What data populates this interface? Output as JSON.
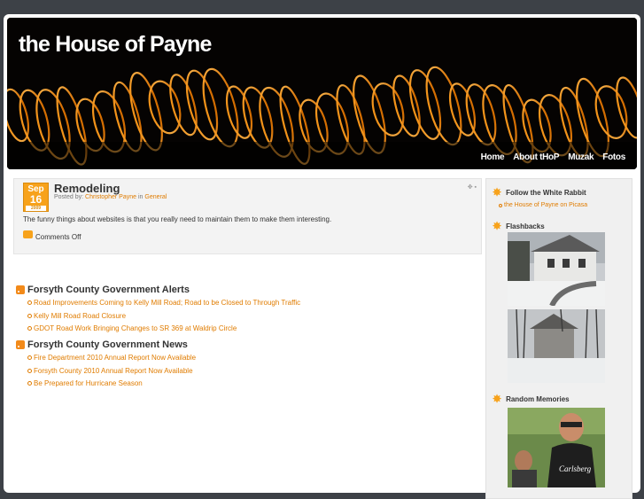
{
  "site": {
    "title": "the House of Payne"
  },
  "nav": [
    {
      "label": "Home"
    },
    {
      "label": "About tHoP"
    },
    {
      "label": "Muzak"
    },
    {
      "label": "Fotos"
    }
  ],
  "post": {
    "date_month": "Sep",
    "date_day": "16",
    "date_year": "2009",
    "title": "Remodeling",
    "meta_prefix": "Posted by:",
    "author": "Christopher Payne",
    "meta_in": "in",
    "category": "General",
    "body": "The funny things about websites is that you really need to maintain them to make them interesting.",
    "comments": "Comments Off"
  },
  "feeds": [
    {
      "title": "Forsyth County Government Alerts",
      "items": [
        "Road Improvements Coming to Kelly Mill Road; Road to be Closed to Through Traffic",
        "Kelly Mill Road Road Closure",
        "GDOT Road Work Bringing Changes to SR 369 at Waldrip Circle"
      ]
    },
    {
      "title": "Forsyth County Government News",
      "items": [
        "Fire Department 2010 Annual Report Now Available",
        "Forsyth County 2010 Annual Report Now Available",
        "Be Prepared for Hurricane Season"
      ]
    }
  ],
  "sidebar": {
    "follow_title": "Follow the White Rabbit",
    "follow_link": "the House of Payne on Picasa",
    "flashbacks_title": "Flashbacks",
    "random_title": "Random Memories"
  }
}
